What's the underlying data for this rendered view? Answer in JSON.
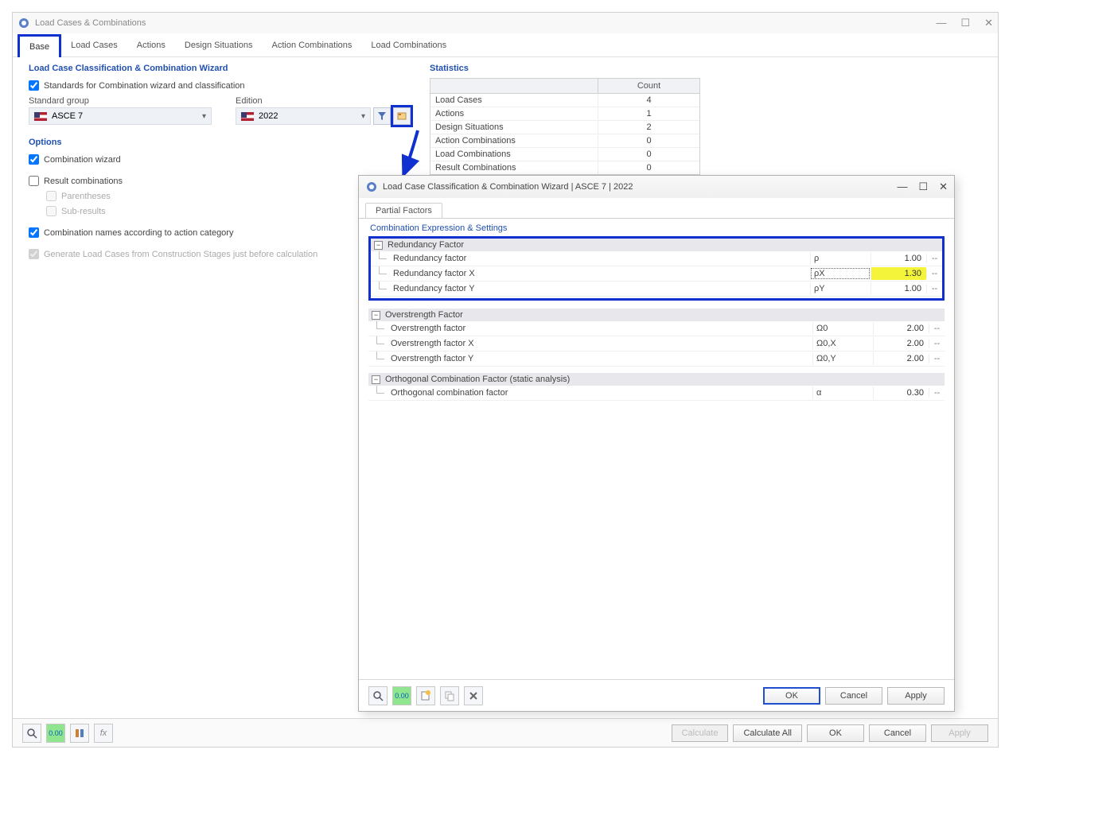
{
  "main": {
    "title": "Load Cases & Combinations",
    "tabs": [
      "Base",
      "Load Cases",
      "Actions",
      "Design Situations",
      "Action Combinations",
      "Load Combinations"
    ],
    "active_tab": 0,
    "wizard_header": "Load Case Classification & Combination Wizard",
    "standards_checkbox": "Standards for Combination wizard and classification",
    "standard_group_label": "Standard group",
    "standard_group_value": "ASCE 7",
    "edition_label": "Edition",
    "edition_value": "2022",
    "options_header": "Options",
    "opt_combination_wizard": "Combination wizard",
    "opt_result_combinations": "Result combinations",
    "opt_parentheses": "Parentheses",
    "opt_sub_results": "Sub-results",
    "opt_names_by_category": "Combination names according to action category",
    "opt_generate_lc": "Generate Load Cases from Construction Stages just before calculation",
    "stats_header": "Statistics",
    "stats_count_label": "Count",
    "stats_rows": [
      {
        "label": "Load Cases",
        "value": "4"
      },
      {
        "label": "Actions",
        "value": "1"
      },
      {
        "label": "Design Situations",
        "value": "2"
      },
      {
        "label": "Action Combinations",
        "value": "0"
      },
      {
        "label": "Load Combinations",
        "value": "0"
      },
      {
        "label": "Result Combinations",
        "value": "0"
      }
    ],
    "footer": {
      "calculate": "Calculate",
      "calculate_all": "Calculate All",
      "ok": "OK",
      "cancel": "Cancel",
      "apply": "Apply"
    }
  },
  "modal": {
    "title": "Load Case Classification & Combination Wizard | ASCE 7 | 2022",
    "tab": "Partial Factors",
    "sub_header": "Combination Expression & Settings",
    "groups": [
      {
        "name": "Redundancy Factor",
        "rows": [
          {
            "label": "Redundancy factor",
            "symbol": "ρ",
            "value": "1.00",
            "unit": "--",
            "hl": false,
            "boxed": false
          },
          {
            "label": "Redundancy factor X",
            "symbol": "ρX",
            "value": "1.30",
            "unit": "--",
            "hl": true,
            "boxed": true
          },
          {
            "label": "Redundancy factor Y",
            "symbol": "ρY",
            "value": "1.00",
            "unit": "--",
            "hl": false,
            "boxed": false
          }
        ],
        "boxed": true
      },
      {
        "name": "Overstrength Factor",
        "rows": [
          {
            "label": "Overstrength factor",
            "symbol": "Ω0",
            "value": "2.00",
            "unit": "--"
          },
          {
            "label": "Overstrength factor X",
            "symbol": "Ω0,X",
            "value": "2.00",
            "unit": "--"
          },
          {
            "label": "Overstrength factor Y",
            "symbol": "Ω0,Y",
            "value": "2.00",
            "unit": "--"
          }
        ],
        "boxed": false
      },
      {
        "name": "Orthogonal Combination Factor (static analysis)",
        "rows": [
          {
            "label": "Orthogonal combination factor",
            "symbol": "α",
            "value": "0.30",
            "unit": "--"
          }
        ],
        "boxed": false
      }
    ],
    "footer": {
      "ok": "OK",
      "cancel": "Cancel",
      "apply": "Apply"
    }
  }
}
